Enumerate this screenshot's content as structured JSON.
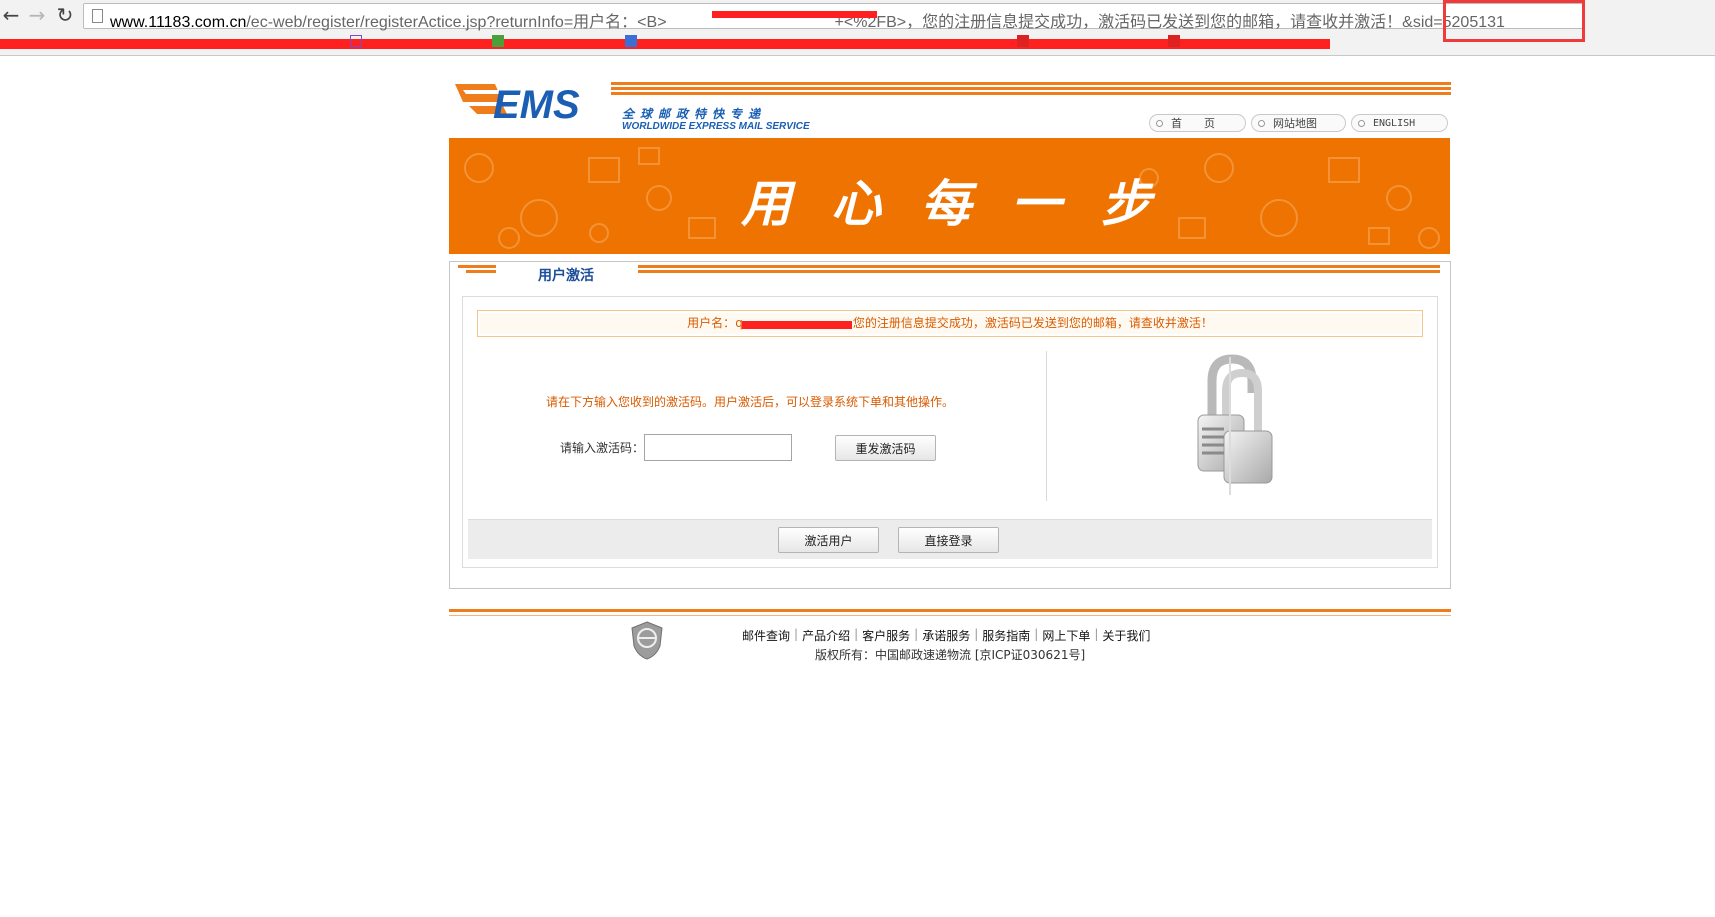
{
  "browser": {
    "url_host": "www.11183.com.cn",
    "url_path": "/ec-web/register/registerActice.jsp?returnInfo=用户名：<B>",
    "url_tail": "+<%2FB>，您的注册信息提交成功，激活码已发送到您的邮箱，请查收并激活！",
    "url_sid": "&sid=5205131"
  },
  "header": {
    "logo_text": "EMS",
    "slogan_cn": "全球邮政特快专递",
    "slogan_en": "WORLDWIDE EXPRESS MAIL SERVICE",
    "toplinks": [
      "首　　页",
      "网站地图",
      "ENGLISH"
    ]
  },
  "banner": {
    "text": "用心每一步"
  },
  "section": {
    "tab_title": "用户激活",
    "notice_prefix": "用户名：",
    "notice_user_visible": "q",
    "notice_suffix": "您的注册信息提交成功，激活码已发送到您的邮箱，请查收并激活！",
    "instruction": "请在下方输入您收到的激活码。用户激活后，可以登录系统下单和其他操作。",
    "code_label": "请输入激活码：",
    "code_value": "",
    "resend_label": "重发激活码",
    "activate_label": "激活用户",
    "login_label": "直接登录"
  },
  "footer": {
    "links": [
      "邮件查询",
      "产品介绍",
      "客户服务",
      "承诺服务",
      "服务指南",
      "网上下单",
      "关于我们"
    ],
    "copyright": "版权所有：中国邮政速递物流 [京ICP证030621号]"
  },
  "colors": {
    "accent": "#ee7300",
    "brand_blue": "#1a5fb4",
    "notice_text": "#d95b00"
  }
}
